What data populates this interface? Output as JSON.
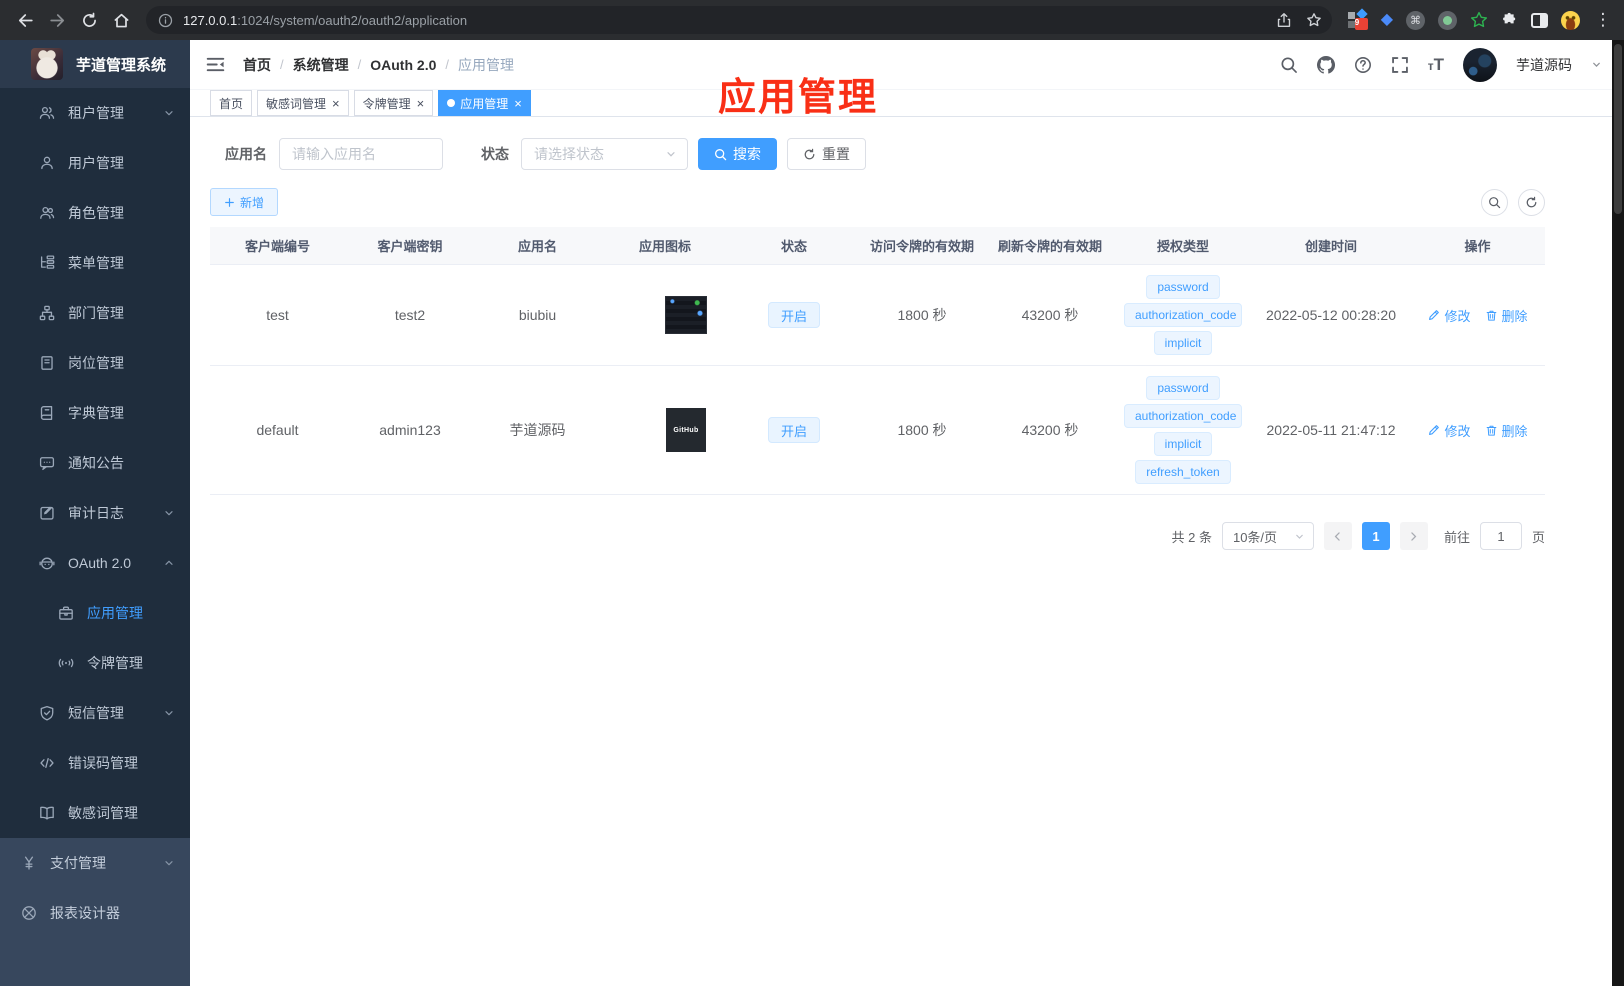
{
  "browser": {
    "url_host": "127.0.0.1",
    "url_path": ":1024/system/oauth2/oauth2/application",
    "extension_badge": "9"
  },
  "sidebar": {
    "title": "芋道管理系统",
    "menu": [
      {
        "key": "tenant",
        "label": "租户管理",
        "icon": "users-icon",
        "chevron": "down"
      },
      {
        "key": "user",
        "label": "用户管理",
        "icon": "user-icon"
      },
      {
        "key": "role",
        "label": "角色管理",
        "icon": "role-icon"
      },
      {
        "key": "menu",
        "label": "菜单管理",
        "icon": "menu-tree-icon"
      },
      {
        "key": "dept",
        "label": "部门管理",
        "icon": "org-icon"
      },
      {
        "key": "post",
        "label": "岗位管理",
        "icon": "post-icon"
      },
      {
        "key": "dict",
        "label": "字典管理",
        "icon": "dict-icon"
      },
      {
        "key": "notice",
        "label": "通知公告",
        "icon": "notice-icon"
      },
      {
        "key": "audit-log",
        "label": "审计日志",
        "icon": "log-icon",
        "chevron": "down"
      },
      {
        "key": "oauth2",
        "label": "OAuth 2.0",
        "icon": "robot-icon",
        "chevron": "up"
      },
      {
        "key": "oauth2-application",
        "label": "应用管理",
        "icon": "briefcase-icon",
        "sub": true,
        "active": true
      },
      {
        "key": "oauth2-token",
        "label": "令牌管理",
        "icon": "signal-icon",
        "sub": true
      },
      {
        "key": "sms",
        "label": "短信管理",
        "icon": "shield-icon",
        "chevron": "down"
      },
      {
        "key": "error-code",
        "label": "错误码管理",
        "icon": "code-icon"
      },
      {
        "key": "sensitive-word",
        "label": "敏感词管理",
        "icon": "book-open-icon"
      },
      {
        "key": "pay",
        "label": "支付管理",
        "icon": "yen-icon",
        "chevron": "down",
        "root": true
      },
      {
        "key": "report-designer",
        "label": "报表设计器",
        "icon": "report-icon",
        "root": true
      }
    ]
  },
  "header": {
    "breadcrumb": [
      "首页",
      "系统管理",
      "OAuth 2.0",
      "应用管理"
    ],
    "username": "芋道源码"
  },
  "tabs": [
    {
      "key": "home",
      "label": "首页"
    },
    {
      "key": "sensitive-word",
      "label": "敏感词管理",
      "closable": true
    },
    {
      "key": "token",
      "label": "令牌管理",
      "closable": true
    },
    {
      "key": "application",
      "label": "应用管理",
      "closable": true,
      "active": true
    }
  ],
  "annotation": "应用管理",
  "filters": {
    "name_label": "应用名",
    "name_placeholder": "请输入应用名",
    "status_label": "状态",
    "status_placeholder": "请选择状态",
    "search_label": "搜索",
    "reset_label": "重置"
  },
  "toolbar": {
    "add_label": "新增"
  },
  "table": {
    "columns": [
      {
        "key": "client_id",
        "label": "客户端编号"
      },
      {
        "key": "client_secret",
        "label": "客户端密钥"
      },
      {
        "key": "app_name",
        "label": "应用名"
      },
      {
        "key": "app_icon",
        "label": "应用图标"
      },
      {
        "key": "status",
        "label": "状态"
      },
      {
        "key": "access_validity",
        "label": "访问令牌的有效期"
      },
      {
        "key": "refresh_validity",
        "label": "刷新令牌的有效期"
      },
      {
        "key": "grant_types",
        "label": "授权类型"
      },
      {
        "key": "created_at",
        "label": "创建时间"
      },
      {
        "key": "actions",
        "label": "操作"
      }
    ],
    "rows": [
      {
        "client_id": "test",
        "client_secret": "test2",
        "app_name": "biubiu",
        "app_icon": "screenshot-thumbnail",
        "app_icon_label": "",
        "status": "开启",
        "access_validity": "1800 秒",
        "refresh_validity": "43200 秒",
        "grant_types": [
          "password",
          "authorization_code",
          "implicit"
        ],
        "created_at": "2022-05-12 00:28:20"
      },
      {
        "client_id": "default",
        "client_secret": "admin123",
        "app_name": "芋道源码",
        "app_icon": "github-logo",
        "app_icon_label": "GitHub",
        "status": "开启",
        "access_validity": "1800 秒",
        "refresh_validity": "43200 秒",
        "grant_types": [
          "password",
          "authorization_code",
          "implicit",
          "refresh_token"
        ],
        "created_at": "2022-05-11 21:47:12"
      }
    ],
    "actions": {
      "edit": "修改",
      "delete": "删除"
    }
  },
  "pagination": {
    "total": "共 2 条",
    "page_size": "10条/页",
    "current": "1",
    "goto_label": "前往",
    "goto_value": "1",
    "page_label": "页"
  }
}
